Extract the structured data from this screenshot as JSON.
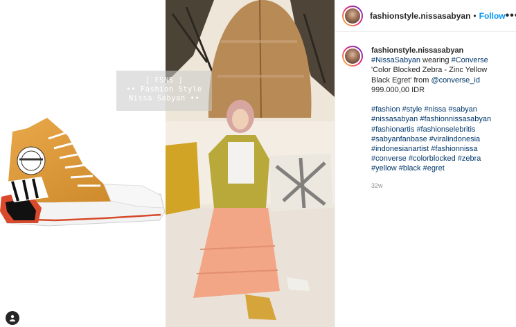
{
  "post": {
    "username": "fashionstyle.nissasabyan",
    "follow_label": "Follow",
    "separator": "•",
    "more_label": "•••",
    "watermark": {
      "line1": "[ FSNS ]",
      "line2": "•• Fashion Style",
      "line3": "Nissa Sabyan ••"
    },
    "caption": {
      "username": "fashionstyle.nissasabyan",
      "tag_nissasabyan": "#NissaSabyan",
      "t1": " wearing ",
      "tag_converse": "#Converse",
      "t2": " 'Color Blocked Zebra - Zinc Yellow Black Egret' from ",
      "mention": "@converse_id",
      "price": "999.000,00 IDR",
      "hashtags": [
        "#fashion",
        "#style",
        "#nissa",
        "#sabyan",
        "#nissasabyan",
        "#fashionnissasabyan",
        "#fashionartis",
        "#fashionselebritis",
        "#sabyanfanbase",
        "#viralindonesia",
        "#indonesianartist",
        "#fashionnissa",
        "#converse",
        "#colorblocked",
        "#zebra",
        "#yellow",
        "#black",
        "#egret"
      ]
    },
    "time_ago": "32w"
  },
  "colors": {
    "link": "#00376b",
    "follow": "#0095f6",
    "muted": "#8e8e8e"
  },
  "icons": {
    "user_tag": "user-tag-icon"
  }
}
